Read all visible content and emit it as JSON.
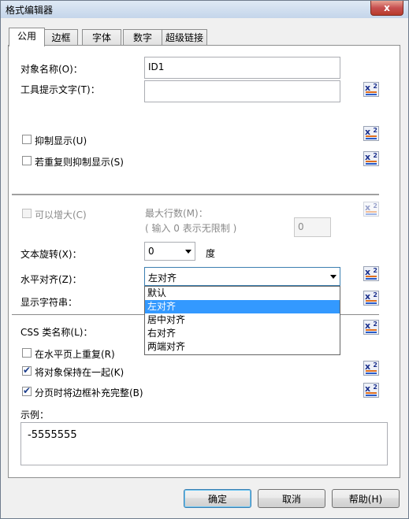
{
  "window": {
    "title": "格式编辑器",
    "close": "x"
  },
  "tabs": [
    "公用",
    "边框",
    "字体",
    "数字",
    "超级链接"
  ],
  "fields": {
    "object_name_label": "对象名称(O)：",
    "object_name_value": "ID1",
    "tooltip_label": "工具提示文字(T)：",
    "tooltip_value": ""
  },
  "checkboxes": {
    "suppress": {
      "label": "抑制显示(U)",
      "checked": false
    },
    "suppress_dup": {
      "label": "若重复则抑制显示(S)",
      "checked": false
    },
    "can_grow": {
      "label": "可以增大(C)",
      "checked": false,
      "disabled": true
    },
    "repeat_horizontal": {
      "label": "在水平页上重复(R)",
      "checked": false
    },
    "keep_together": {
      "label": "将对象保持在一起(K)",
      "checked": true
    },
    "close_border": {
      "label": "分页时将边框补充完整(B)",
      "checked": true
    }
  },
  "max_lines": {
    "label": "最大行数(M)：",
    "hint": "( 输入 0 表示无限制 )",
    "value": "0"
  },
  "rotation": {
    "label": "文本旋转(X)：",
    "value": "0",
    "unit": "度"
  },
  "halign": {
    "label": "水平对齐(Z)：",
    "value": "左对齐",
    "options": [
      "默认",
      "左对齐",
      "居中对齐",
      "右对齐",
      "两端对齐"
    ]
  },
  "display_string_label": "显示字符串：",
  "css_label": "CSS 类名称(L)：",
  "example": {
    "label": "示例：",
    "value": "-5555555"
  },
  "formula_button": {
    "x": "x",
    "s": "2"
  },
  "buttons": {
    "ok": "确定",
    "cancel": "取消",
    "help": "帮助(H)"
  }
}
